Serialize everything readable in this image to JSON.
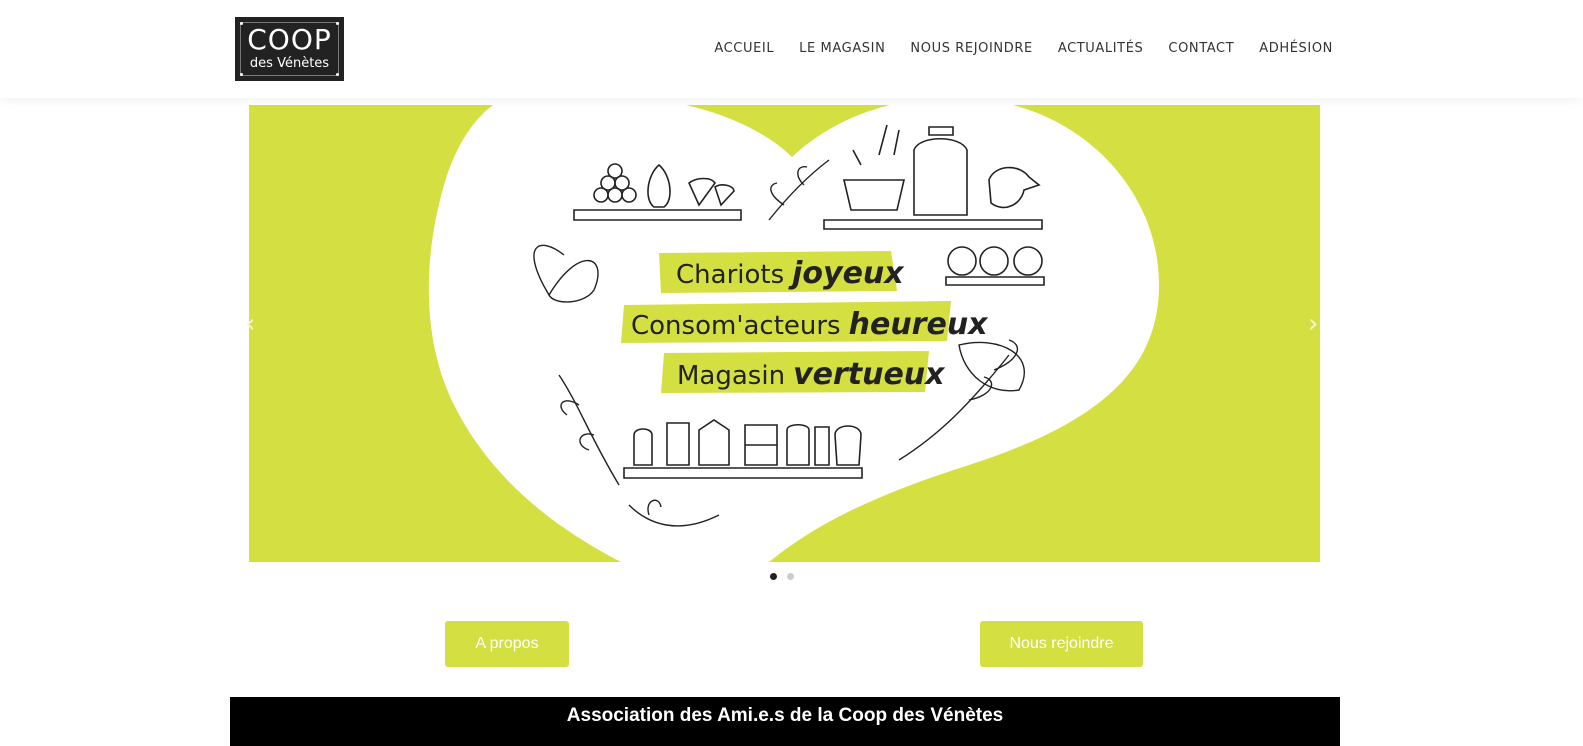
{
  "logo": {
    "main": "COOP",
    "sub": "des Vénètes"
  },
  "nav": [
    "ACCUEIL",
    "LE MAGASIN",
    "NOUS REJOINDRE",
    "ACTUALITÉS",
    "CONTACT",
    "ADHÉSION"
  ],
  "slider": {
    "lines": [
      {
        "light": "Chariots",
        "bold": "joyeux"
      },
      {
        "light": "Consom'acteurs",
        "bold": "heureux"
      },
      {
        "light": "Magasin",
        "bold": "vertueux"
      }
    ],
    "prev_icon": "chevron-left-icon",
    "next_icon": "chevron-right-icon",
    "active_dot": 1,
    "dot_count": 2
  },
  "buttons": {
    "about": "A propos",
    "join": "Nous rejoindre"
  },
  "banner": {
    "text": "Association des Ami.e.s de la Coop des Vénètes"
  },
  "colors": {
    "accent": "#d4df42",
    "dark": "#000000"
  }
}
